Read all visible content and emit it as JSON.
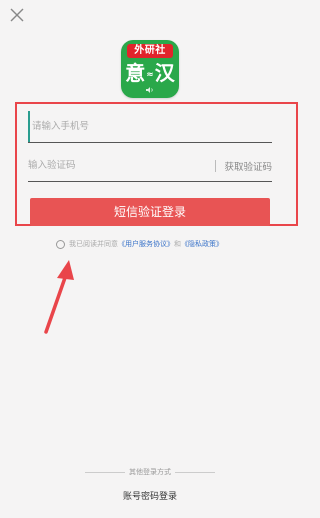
{
  "header": {
    "close_icon": "close-icon"
  },
  "logo": {
    "banner": "外研社",
    "char_left": "意",
    "separator": "≈",
    "char_right": "汉",
    "sound_icon": "speaker-icon",
    "brand_red": "#e2242b",
    "brand_green": "#2aa84a"
  },
  "form": {
    "phone_placeholder": "请输入手机号",
    "phone_value": "",
    "code_placeholder": "输入验证码",
    "code_value": "",
    "get_code_label": "获取验证码",
    "login_button_label": "短信验证登录",
    "login_button_color": "#e85454"
  },
  "agreement": {
    "prefix": "我已阅读并同意",
    "user_agreement": "《用户服务协议》",
    "and": "和",
    "privacy_policy": "《隐私政策》",
    "checked": false
  },
  "footer": {
    "other_methods_label": "其他登录方式",
    "password_login_label": "账号密码登录"
  },
  "annotations": {
    "highlight_color": "#e9454a",
    "arrow_color": "#e9454a"
  }
}
